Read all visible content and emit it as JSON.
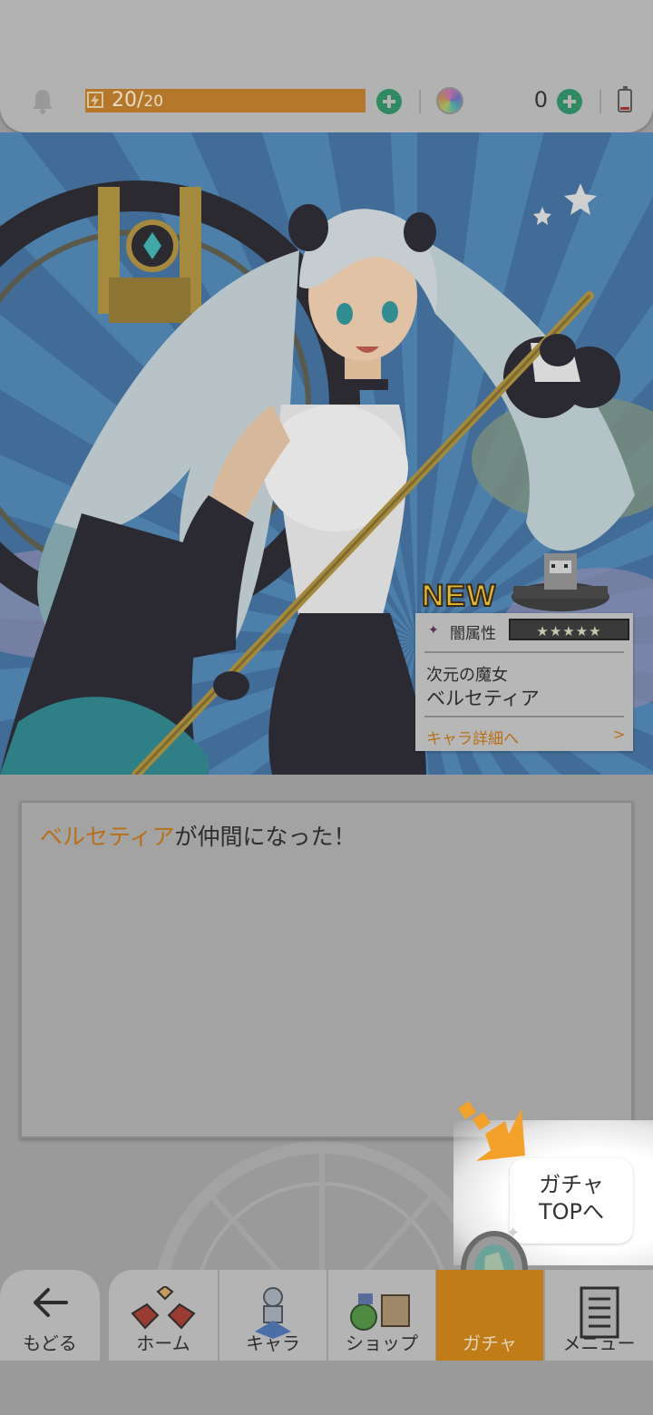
{
  "header": {
    "stamina_current": "20/",
    "stamina_max": "20",
    "gem_count": "0"
  },
  "card": {
    "new_label": "NEW",
    "attribute": "闇属性",
    "stars": "★★★★★",
    "title": "次元の魔女",
    "name": "ベルセティア",
    "link": "キャラ詳細へ",
    "link_arrow": ">"
  },
  "message": {
    "name": "ベルセティア",
    "suffix": "が仲間になった！"
  },
  "tooltip": {
    "line1": "ガチャ",
    "line2": "TOPへ"
  },
  "nav": {
    "back": "もどる",
    "home": "ホーム",
    "chara": "キャラ",
    "shop": "ショップ",
    "gacha": "ガチャ",
    "menu": "メニュー"
  },
  "colors": {
    "accent": "#b86f16",
    "active_tab": "#c07c17",
    "plus": "#2e8a63"
  }
}
